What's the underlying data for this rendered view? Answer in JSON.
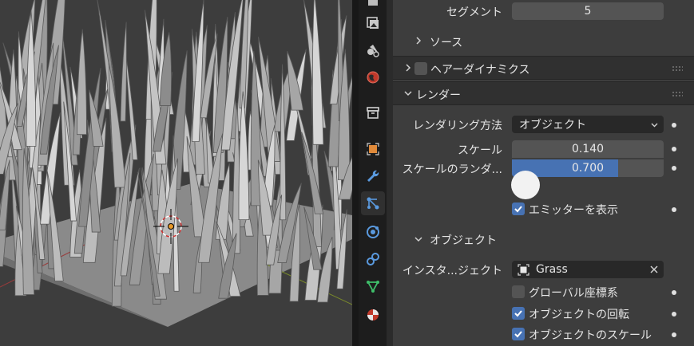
{
  "properties": {
    "segments": {
      "label": "セグメント",
      "value": "5"
    },
    "source_panel": {
      "label": "ソース"
    },
    "hair_dynamics": {
      "label": "ヘアーダイナミクス",
      "enabled": false
    },
    "render_panel": {
      "label": "レンダー"
    },
    "render_as": {
      "label": "レンダリング方法",
      "value": "オブジェクト"
    },
    "scale": {
      "label": "スケール",
      "value": "0.140"
    },
    "scale_randomness": {
      "label": "スケールのランダ...",
      "value": "0.700",
      "fraction": 0.7
    },
    "show_emitter": {
      "label": "エミッターを表示",
      "checked": true
    },
    "object_panel": {
      "label": "オブジェクト"
    },
    "instance_object": {
      "label": "インスタ...ジェクト",
      "value": "Grass"
    },
    "global_coords": {
      "label": "グローバル座標系",
      "checked": false
    },
    "object_rotation": {
      "label": "オブジェクトの回転",
      "checked": true
    },
    "object_scale": {
      "label": "オブジェクトのスケール",
      "checked": true
    }
  },
  "colors": {
    "accent": "#4772b3",
    "panel": "#3d3d3d",
    "field": "#545454"
  },
  "tabs": [
    "render-icon",
    "output-icon",
    "view-layer-icon",
    "scene-icon",
    "world-icon",
    "collection-icon",
    "object-icon",
    "modifier-icon",
    "particles-icon",
    "physics-icon",
    "constraints-icon",
    "data-icon",
    "material-icon"
  ]
}
